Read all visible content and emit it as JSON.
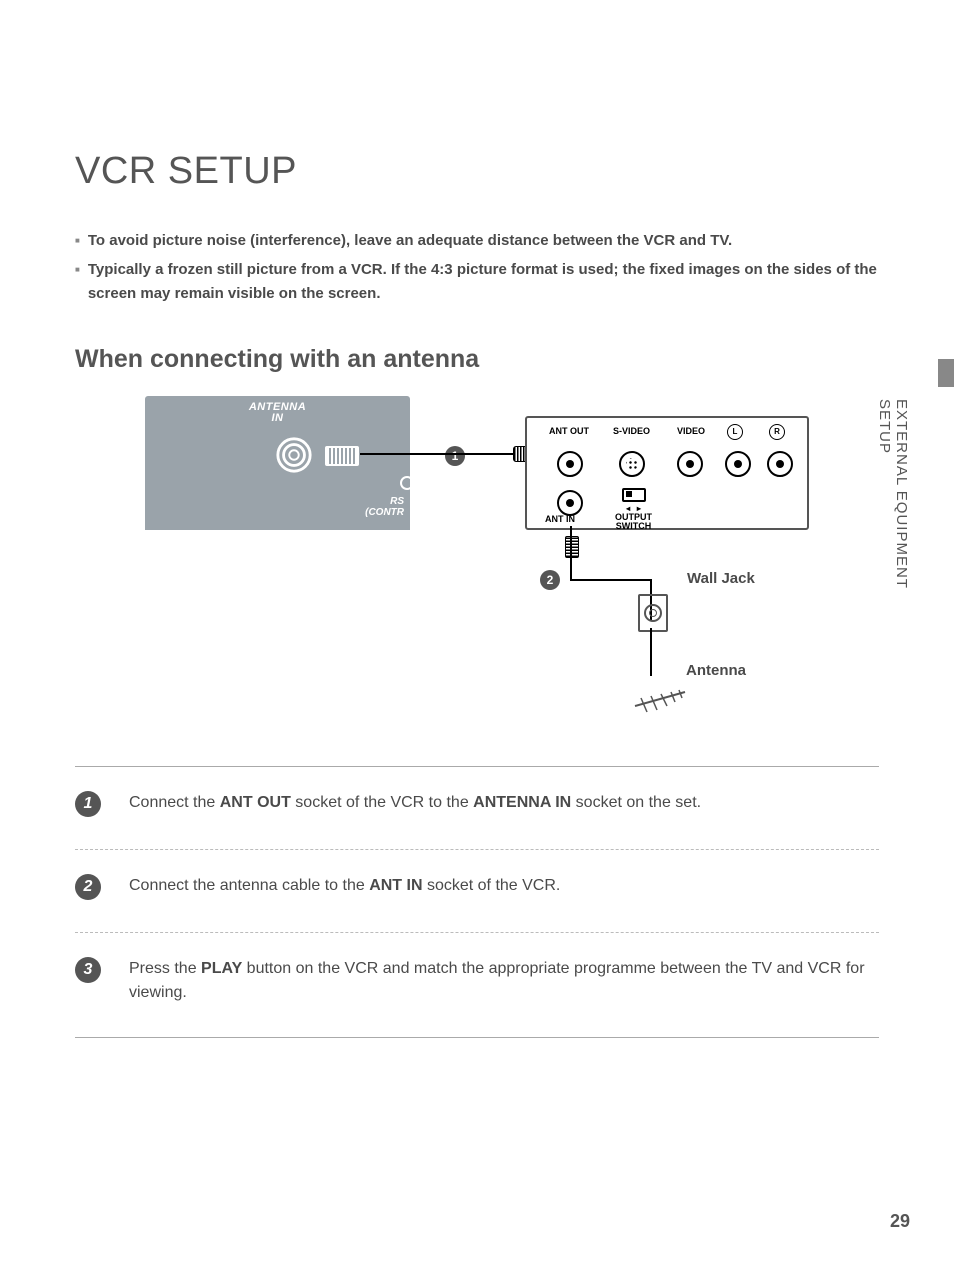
{
  "title": "VCR SETUP",
  "bullets": [
    "To avoid picture noise (interference), leave an adequate distance between the VCR and TV.",
    "Typically a frozen still picture from a VCR. If the 4:3 picture format is used; the fixed images on the sides of the screen may remain visible on the screen."
  ],
  "subheading": "When connecting with an antenna",
  "diagram": {
    "tv_label_line1": "ANTENNA",
    "tv_label_line2": "IN",
    "tv_rs_line1": "RS",
    "tv_rs_line2": "(CONTR",
    "badge1": "1",
    "badge2": "2",
    "vcr_labels": {
      "ant_out": "ANT OUT",
      "ant_in": "ANT IN",
      "s_video": "S-VIDEO",
      "video": "VIDEO",
      "l": "L",
      "r": "R",
      "output_switch_line1": "OUTPUT",
      "output_switch_line2": "SWITCH"
    },
    "wall_jack_label": "Wall Jack",
    "antenna_label": "Antenna"
  },
  "steps": [
    {
      "num": "1",
      "parts": [
        "Connect the ",
        "ANT OUT",
        " socket of the VCR to the ",
        "ANTENNA IN",
        " socket on the set."
      ]
    },
    {
      "num": "2",
      "parts": [
        "Connect the antenna cable to the ",
        "ANT IN",
        " socket of the VCR."
      ]
    },
    {
      "num": "3",
      "parts": [
        "Press the ",
        "PLAY",
        " button on the VCR and match the appropriate programme between the TV and VCR for viewing."
      ]
    }
  ],
  "side_text": "EXTERNAL EQUIPMENT SETUP",
  "page_number": "29"
}
